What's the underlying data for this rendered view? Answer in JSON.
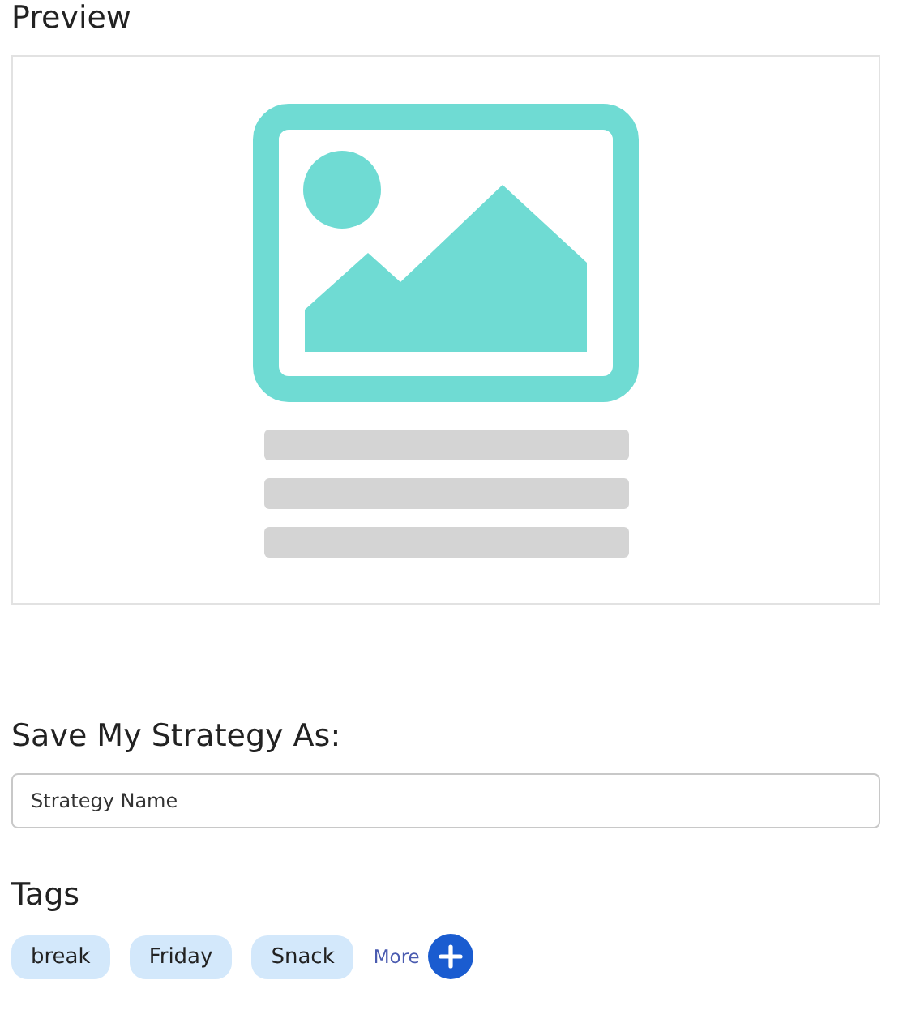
{
  "preview": {
    "title": "Preview"
  },
  "save": {
    "label": "Save My Strategy As:",
    "placeholder": "Strategy Name"
  },
  "tags": {
    "title": "Tags",
    "items": [
      "break",
      "Friday",
      "Snack"
    ],
    "more": "More"
  }
}
